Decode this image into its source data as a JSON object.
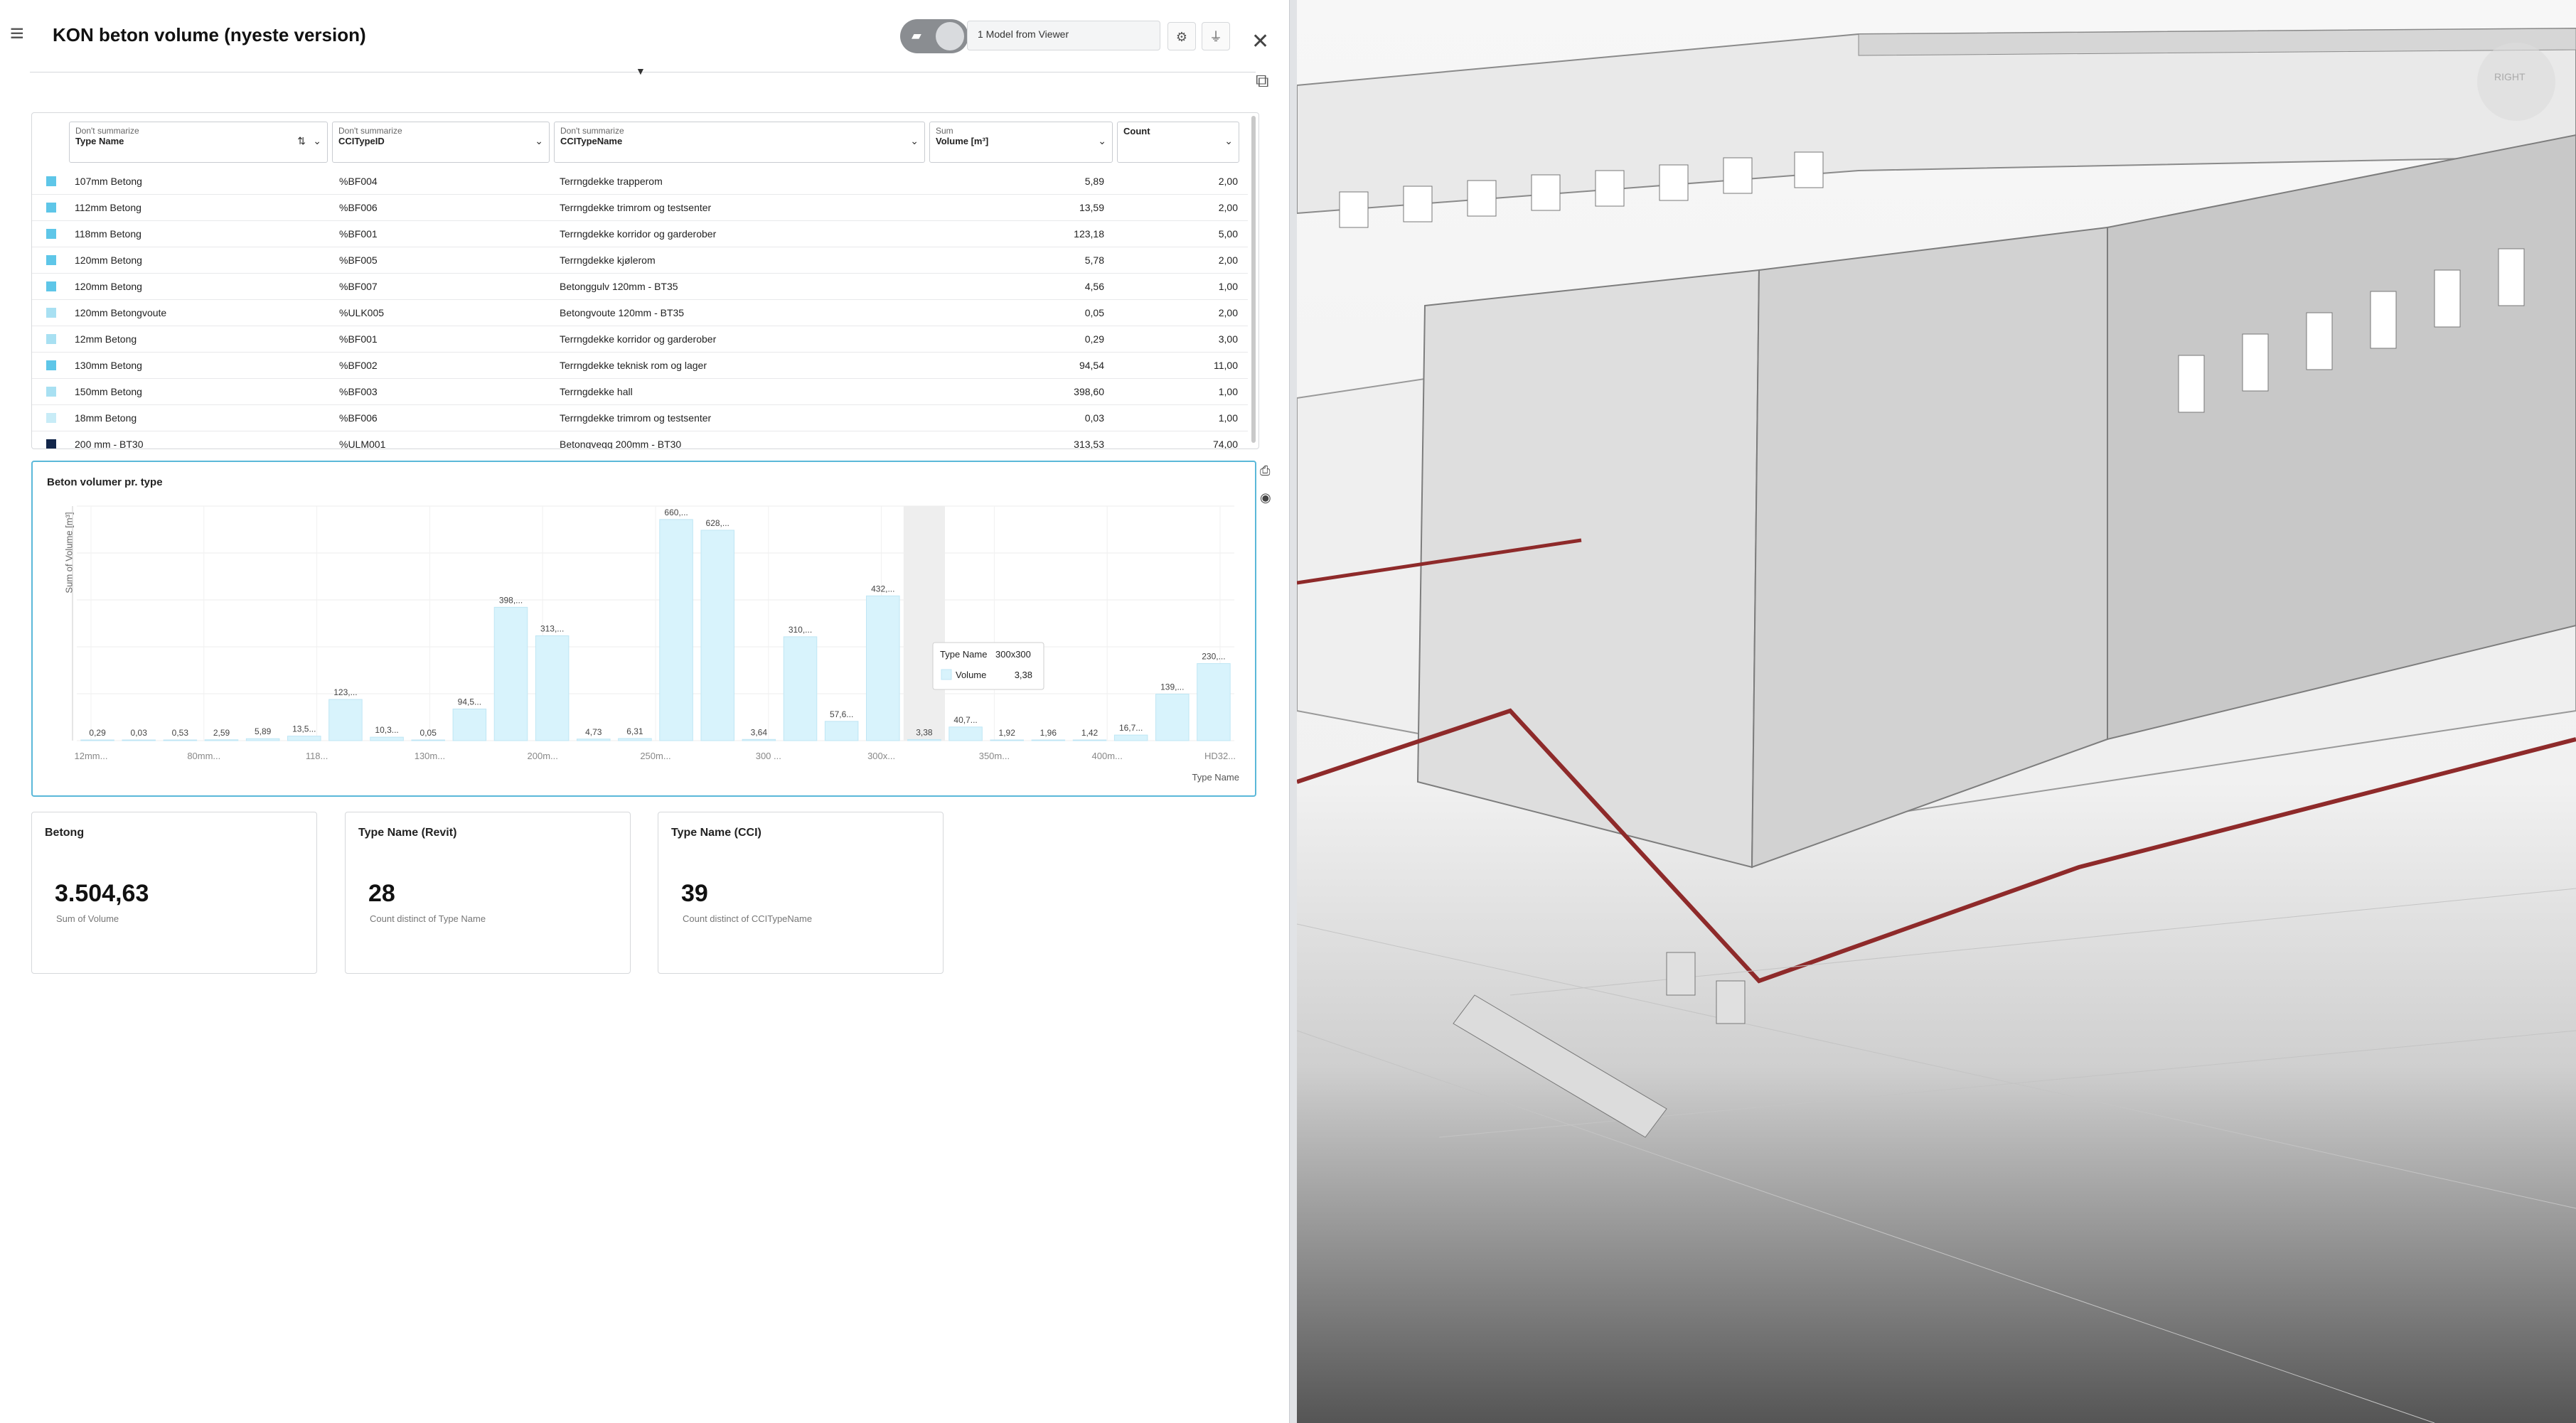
{
  "header": {
    "title": "KON beton volume (nyeste version)",
    "model_selector": "1 Model from Viewer"
  },
  "table": {
    "columns": [
      {
        "pre": "Don't summarize",
        "label": "Type Name"
      },
      {
        "pre": "Don't summarize",
        "label": "CCITypeID"
      },
      {
        "pre": "Don't summarize",
        "label": "CCITypeName"
      },
      {
        "pre": "Sum",
        "label": "Volume [m³]"
      },
      {
        "pre": "",
        "label": "Count"
      }
    ],
    "rows": [
      {
        "color": "#5ec6e8",
        "type": "107mm Betong",
        "id": "%BF004",
        "name": "Terrngdekke trapperom",
        "volume": "5,89",
        "count": "2,00"
      },
      {
        "color": "#5ec6e8",
        "type": "112mm Betong",
        "id": "%BF006",
        "name": "Terrngdekke trimrom og testsenter",
        "volume": "13,59",
        "count": "2,00"
      },
      {
        "color": "#5ec6e8",
        "type": "118mm Betong",
        "id": "%BF001",
        "name": "Terrngdekke korridor og garderober",
        "volume": "123,18",
        "count": "5,00"
      },
      {
        "color": "#5ec6e8",
        "type": "120mm Betong",
        "id": "%BF005",
        "name": "Terrngdekke kjølerom",
        "volume": "5,78",
        "count": "2,00"
      },
      {
        "color": "#5ec6e8",
        "type": "120mm Betong",
        "id": "%BF007",
        "name": "Betonggulv 120mm - BT35",
        "volume": "4,56",
        "count": "1,00"
      },
      {
        "color": "#a8e0f2",
        "type": "120mm Betongvoute",
        "id": "%ULK005",
        "name": "Betongvoute 120mm - BT35",
        "volume": "0,05",
        "count": "2,00"
      },
      {
        "color": "#a8e0f2",
        "type": "12mm Betong",
        "id": "%BF001",
        "name": "Terrngdekke korridor og garderober",
        "volume": "0,29",
        "count": "3,00"
      },
      {
        "color": "#5ec6e8",
        "type": "130mm Betong",
        "id": "%BF002",
        "name": "Terrngdekke teknisk rom og lager",
        "volume": "94,54",
        "count": "11,00"
      },
      {
        "color": "#a8e0f2",
        "type": "150mm Betong",
        "id": "%BF003",
        "name": "Terrngdekke hall",
        "volume": "398,60",
        "count": "1,00"
      },
      {
        "color": "#c8ecf7",
        "type": "18mm Betong",
        "id": "%BF006",
        "name": "Terrngdekke trimrom og testsenter",
        "volume": "0,03",
        "count": "1,00"
      },
      {
        "color": "#12264a",
        "type": "200 mm - BT30",
        "id": "%ULM001",
        "name": "Betongvegg 200mm - BT30",
        "volume": "313,53",
        "count": "74,00"
      }
    ]
  },
  "chart": {
    "title": "Beton volumer pr. type",
    "tooltip": {
      "key_label": "Type Name",
      "key_value": "300x300",
      "measure_label": "Volume",
      "measure_value": "3,38"
    },
    "bar_color": "#d8f3fc",
    "highlight_color": "#eeeeee"
  },
  "chart_data": {
    "type": "bar",
    "title": "Beton volumer pr. type",
    "xlabel": "Type Name",
    "ylabel": "Sum of Volume [m³]",
    "ylim": [
      0,
      700
    ],
    "grid": true,
    "tick_labels": [
      "12mm...",
      "80mm...",
      "118...",
      "130m...",
      "200m...",
      "250m...",
      "300 ...",
      "300x...",
      "350m...",
      "400m...",
      "HD32..."
    ],
    "data_labels": [
      "0,29",
      "0,03",
      "0,53",
      "2,59",
      "5,89",
      "13,5...",
      "123,...",
      "10,3...",
      "0,05",
      "94,5...",
      "398,...",
      "313,...",
      "4,73",
      "6,31",
      "660,...",
      "628,...",
      "3,64",
      "310,...",
      "57,6...",
      "432,...",
      "3,38",
      "40,7...",
      "1,92",
      "1,96",
      "1,42",
      "16,7...",
      "139,...",
      "230,..."
    ],
    "values": [
      0.29,
      0.03,
      0.53,
      2.59,
      5.89,
      13.5,
      123,
      10.3,
      0.05,
      94.5,
      398,
      313,
      4.73,
      6.31,
      660,
      628,
      3.64,
      310,
      57.6,
      432,
      3.38,
      40.7,
      1.92,
      1.96,
      1.42,
      16.7,
      139,
      230
    ]
  },
  "kpis": [
    {
      "title": "Betong",
      "value": "3.504,63",
      "caption": "Sum of Volume"
    },
    {
      "title": "Type Name (Revit)",
      "value": "28",
      "caption": "Count distinct of Type Name"
    },
    {
      "title": "Type Name (CCI)",
      "value": "39",
      "caption": "Count distinct of CCITypeName"
    }
  ],
  "viewer": {
    "viewcube_label": "RIGHT",
    "icons": {
      "right_toolbar": [
        "panel-icon",
        "home-icon",
        "table-icon",
        "filter-icon",
        "palette-icon",
        "link-icon",
        "checklist-icon",
        "pie-chart-icon",
        "pencil-icon",
        "camera-icon"
      ],
      "bottom_toolbar": [
        "measure-icon",
        "section-icon",
        "hide-icon",
        "cube-icon",
        "box-select-icon",
        "explode-icon",
        "clone-icon",
        "fit-icon"
      ]
    }
  }
}
